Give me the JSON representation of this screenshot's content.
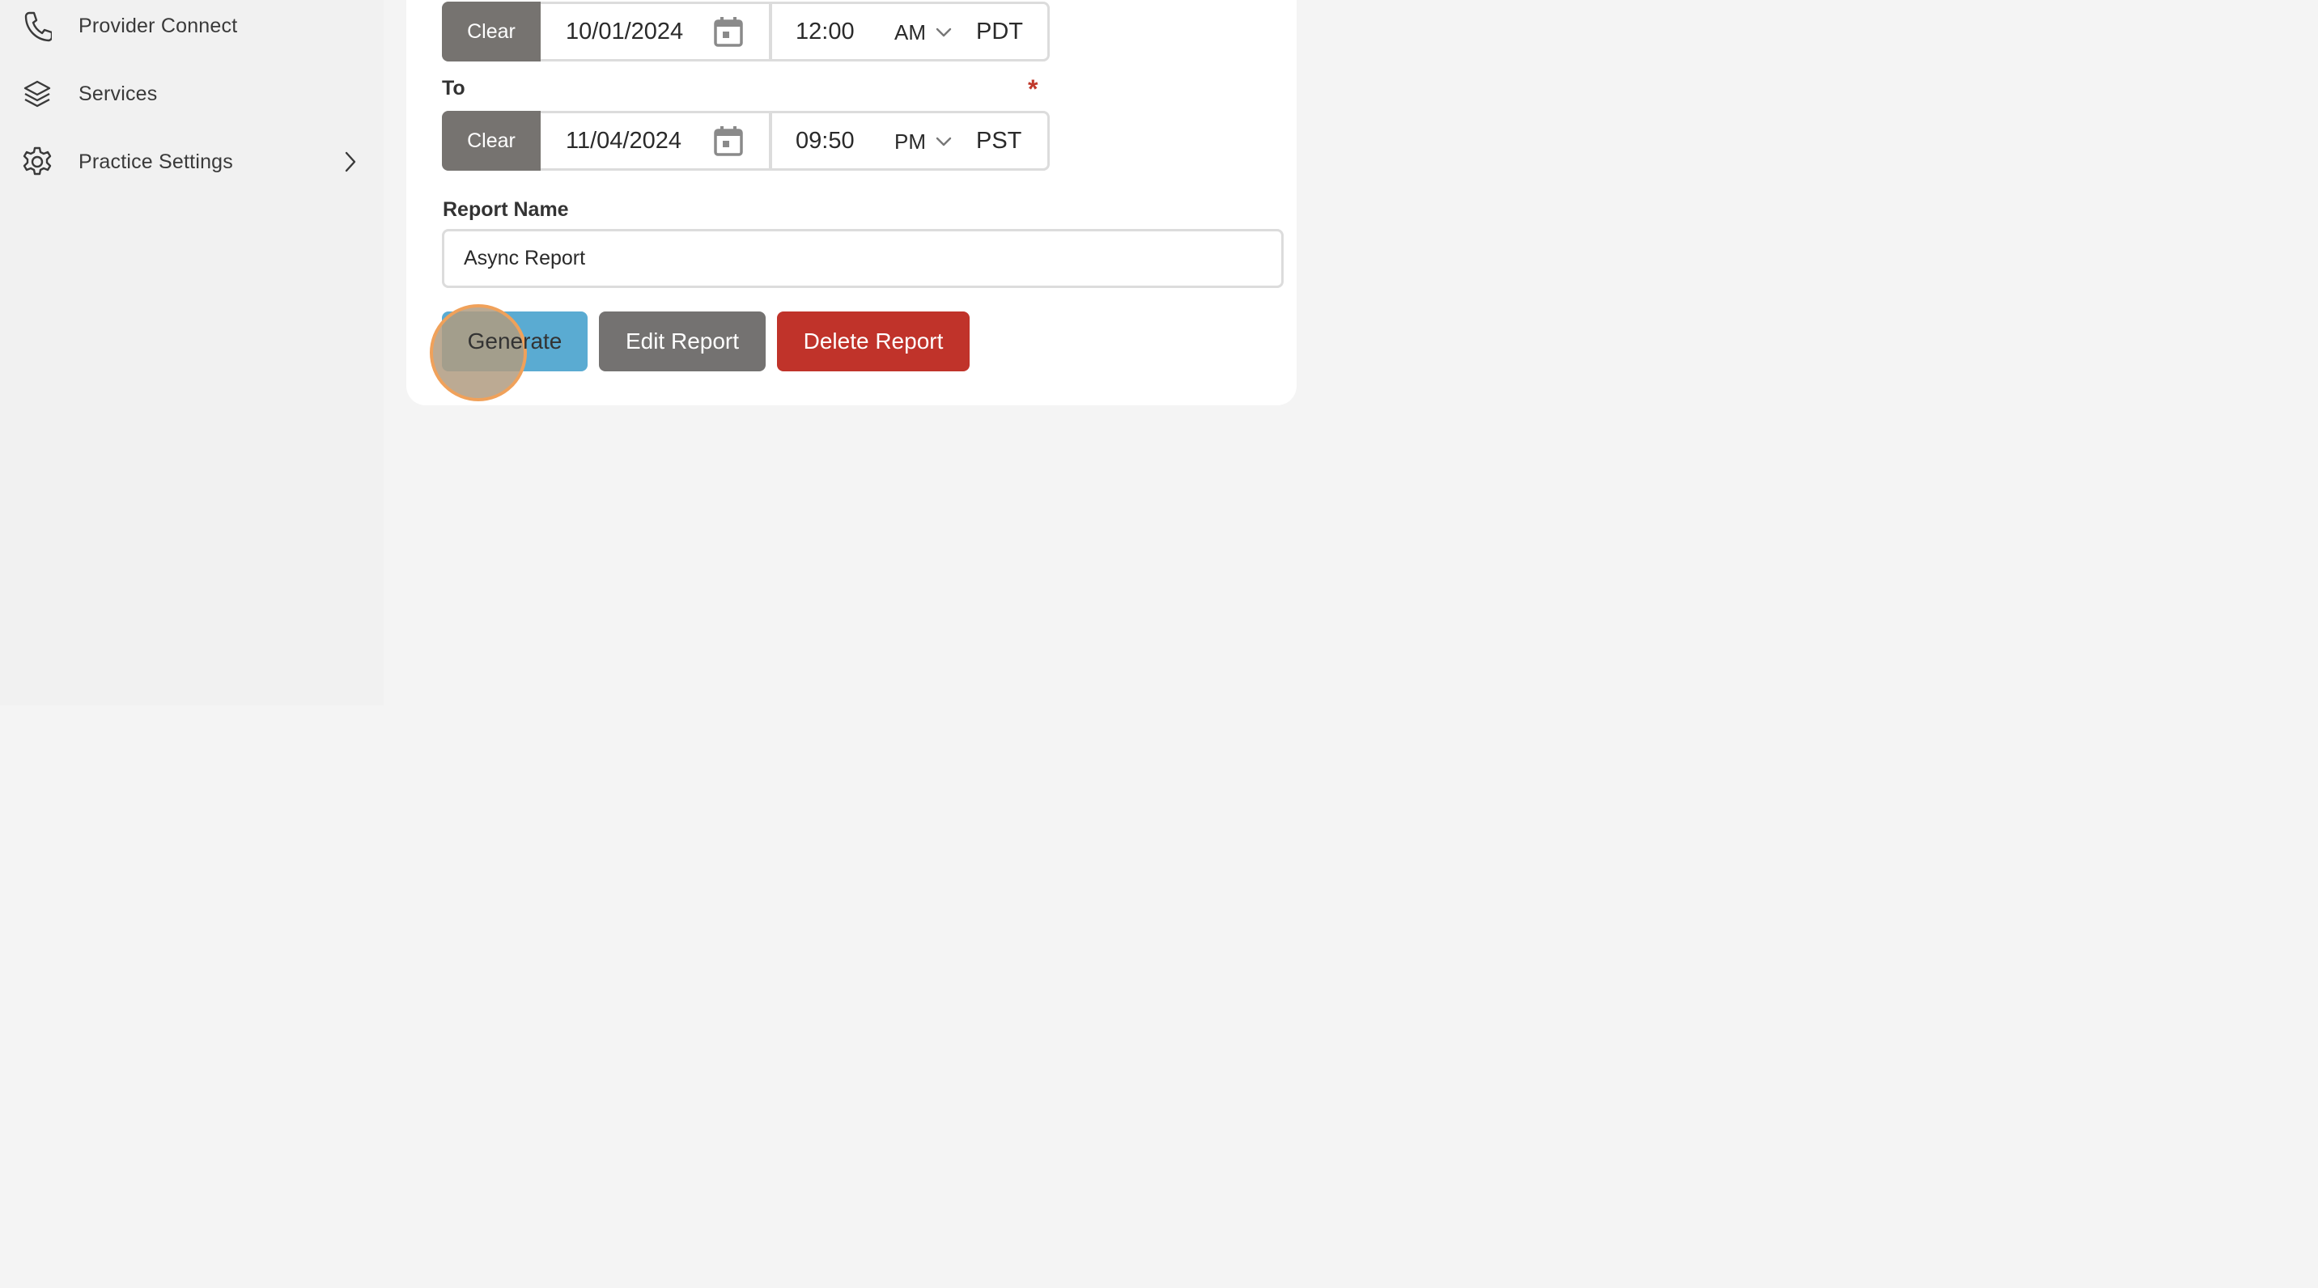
{
  "sidebar": {
    "items": [
      {
        "label": "Provider Connect",
        "icon": "phone-icon"
      },
      {
        "label": "Services",
        "icon": "layers-icon"
      },
      {
        "label": "Practice Settings",
        "icon": "gear-icon",
        "has_children": true
      }
    ]
  },
  "from": {
    "clear_label": "Clear",
    "date": "10/01/2024",
    "time": "12:00",
    "ampm": "AM",
    "timezone": "PDT"
  },
  "to": {
    "label": "To",
    "required_mark": "*",
    "clear_label": "Clear",
    "date": "11/04/2024",
    "time": "09:50",
    "ampm": "PM",
    "timezone": "PST"
  },
  "report_name": {
    "label": "Report Name",
    "value": "Async Report"
  },
  "actions": {
    "generate_label": "Generate",
    "edit_label": "Edit Report",
    "delete_label": "Delete Report"
  },
  "colors": {
    "clear_button": "#767370",
    "generate_button": "#5aabd2",
    "edit_button": "#747271",
    "delete_button": "#c0332a",
    "required": "#c0392b",
    "click_ring": "#f0a15a"
  }
}
